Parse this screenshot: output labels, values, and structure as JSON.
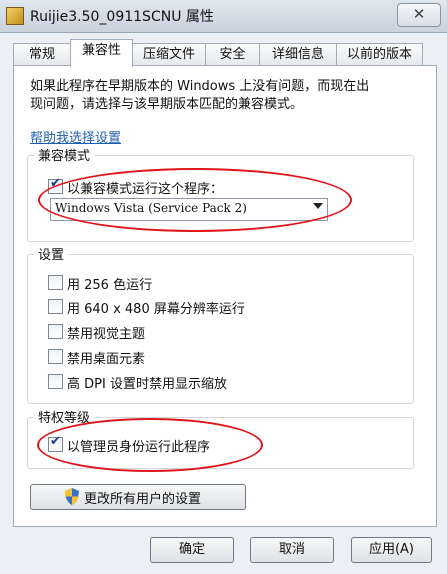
{
  "window": {
    "title": "Ruijie3.50_0911SCNU 属性",
    "close_label": "✕"
  },
  "tabs": [
    {
      "label": "常规"
    },
    {
      "label": "兼容性",
      "active": true
    },
    {
      "label": "压缩文件"
    },
    {
      "label": "安全"
    },
    {
      "label": "详细信息"
    },
    {
      "label": "以前的版本"
    }
  ],
  "compat": {
    "description_line1": "如果此程序在早期版本的 Windows 上没有问题，而现在出",
    "description_line2": "现问题，请选择与该早期版本匹配的兼容模式。",
    "help_link": "帮助我选择设置",
    "mode_group_title": "兼容模式",
    "mode_checkbox_label": "以兼容模式运行这个程序：",
    "mode_checkbox_checked": true,
    "mode_select_value": "Windows Vista (Service Pack 2)"
  },
  "settings": {
    "group_title": "设置",
    "items": [
      {
        "label": "用 256 色运行",
        "checked": false
      },
      {
        "label": "用 640 x 480 屏幕分辨率运行",
        "checked": false
      },
      {
        "label": "禁用视觉主题",
        "checked": false
      },
      {
        "label": "禁用桌面元素",
        "checked": false
      },
      {
        "label": "高 DPI 设置时禁用显示缩放",
        "checked": false
      }
    ]
  },
  "privilege": {
    "group_title": "特权等级",
    "admin_label": "以管理员身份运行此程序",
    "admin_checked": true
  },
  "change_all_users_label": "更改所有用户的设置",
  "buttons": {
    "ok": "确定",
    "cancel": "取消",
    "apply": "应用(A)"
  },
  "colors": {
    "annotation_red": "#e0161b",
    "link_blue": "#1d5fb2"
  }
}
